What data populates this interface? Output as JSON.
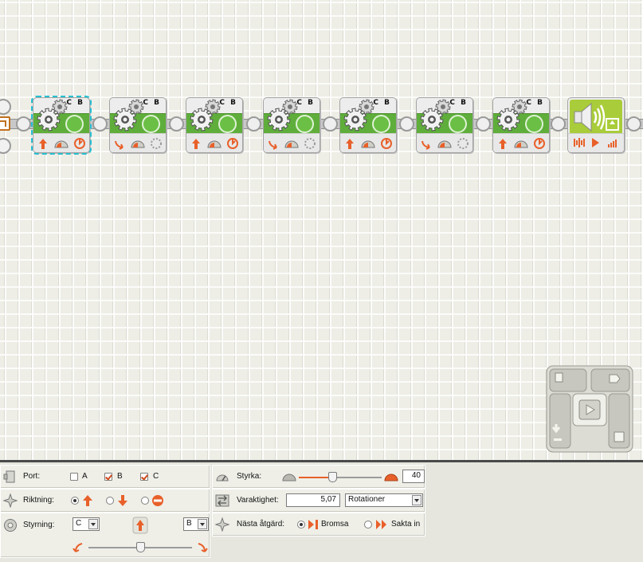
{
  "canvas": {
    "blocks": [
      {
        "ports": "C B",
        "direction": "up",
        "stop_icon": "power-icon",
        "selected": true
      },
      {
        "ports": "C B",
        "direction": "down",
        "stop_icon": "coast-icon",
        "selected": false
      },
      {
        "ports": "C B",
        "direction": "up",
        "stop_icon": "power-icon",
        "selected": false
      },
      {
        "ports": "C B",
        "direction": "down",
        "stop_icon": "coast-icon",
        "selected": false
      },
      {
        "ports": "C B",
        "direction": "up",
        "stop_icon": "power-icon",
        "selected": false
      },
      {
        "ports": "C B",
        "direction": "down",
        "stop_icon": "coast-icon",
        "selected": false
      },
      {
        "ports": "C B",
        "direction": "up",
        "stop_icon": "power-icon",
        "selected": false
      }
    ],
    "sound_block": {
      "icon": "speaker-icon"
    }
  },
  "colors": {
    "move_green": "#5fae3b",
    "sound_lime": "#a9cc3a",
    "accent_orange": "#e8602a",
    "selection": "#26bfd0"
  },
  "panel": {
    "port": {
      "label": "Port:",
      "options": [
        {
          "name": "A",
          "checked": false
        },
        {
          "name": "B",
          "checked": true
        },
        {
          "name": "C",
          "checked": true
        }
      ]
    },
    "direction": {
      "label": "Riktning:",
      "selected": "forward"
    },
    "steering": {
      "label": "Styrning:",
      "left_port": "C",
      "right_port": "B",
      "slider": 0.5
    },
    "power": {
      "label": "Styrka:",
      "value": "40",
      "slider": 0.4
    },
    "duration": {
      "label": "Varaktighet:",
      "value": "5,07",
      "unit": "Rotationer"
    },
    "next_action": {
      "label": "Nästa åtgärd:",
      "brake_label": "Bromsa",
      "coast_label": "Sakta in",
      "selected": "brake"
    }
  }
}
